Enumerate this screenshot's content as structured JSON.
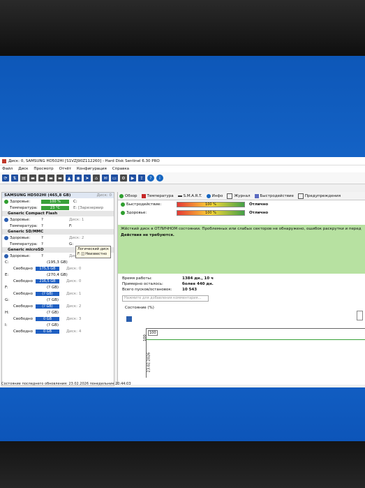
{
  "window": {
    "title": "Диск: 0, SAMSUNG HD502HI [S1VZJ90Z112260] - Hard Disk Sentinel 6.30 PRO"
  },
  "menu": [
    "Файл",
    "Диск",
    "Просмотр",
    "Отчёт",
    "Конфигурация",
    "Справка"
  ],
  "disk_panel": {
    "header": "SAMSUNG HD502HI (465,8 GB)",
    "header_num": "Диск: 0",
    "health_label": "Здоровье:",
    "health_value": "100 %",
    "health_drive": "C:",
    "temp_label": "Температура:",
    "temp_value": "23 °C",
    "temp_drive": "E: [Зарезервир",
    "devices": [
      {
        "name": "Generic Compact Flash",
        "health_label": "Здоровье:",
        "health": "?",
        "temp_label": "Температура:",
        "temp": "?",
        "disk": "Диск: 1",
        "drive": "F:"
      },
      {
        "name": "Generic SD/MMC",
        "health_label": "Здоровье:",
        "health": "?",
        "temp_label": "Температура:",
        "temp": "?",
        "disk": "Диск: 2",
        "drive": "G:"
      },
      {
        "name": "Generic microSD",
        "health_label": "Здоровье:",
        "health": "?",
        "temp_label": "",
        "temp": "",
        "disk": "Диск: 3",
        "drive": ""
      }
    ],
    "tooltip_line1": "Логический диск",
    "tooltip_line2": "F: [] Неизвестно",
    "volumes": [
      {
        "letter": "C:",
        "size": "(195,3 GB)",
        "free_label": "Свободно",
        "free": "175,5 GB",
        "disk": "Диск: 0"
      },
      {
        "letter": "E:",
        "size": "(270,4 GB)",
        "free_label": "Свободно",
        "free": "216,5 GB",
        "disk": "Диск: 0"
      },
      {
        "letter": "F:",
        "size": "(? GB)",
        "free_label": "Свободно",
        "free": "(? GB)",
        "disk": "Диск: 1"
      },
      {
        "letter": "G:",
        "size": "(? GB)",
        "free_label": "Свободно",
        "free": "(? GB)",
        "disk": "Диск: 2"
      },
      {
        "letter": "H:",
        "size": "(? GB)",
        "free_label": "Свободно",
        "free": "0 GB",
        "disk": "Диск: 3"
      },
      {
        "letter": "I:",
        "size": "(? GB)",
        "free_label": "Свободно",
        "free": "0 GB",
        "disk": "Диск: 4"
      }
    ]
  },
  "tabs": [
    "Обзор",
    "Температура",
    "S.M.A.R.T.",
    "Инфо",
    "Журнал",
    "Быстродействие",
    "Предупреждения"
  ],
  "status": {
    "perf_label": "Быстродействие:",
    "perf_value": "100 %",
    "perf_rating": "Отлично",
    "health_label": "Здоровье:",
    "health_value": "100 %",
    "health_rating": "Отлично"
  },
  "message": {
    "line1": "Жёсткий диск в ОТЛИЧНОМ состоянии. Проблемных или слабых секторов не обнаружено, ошибок раскрутки и перед",
    "line2": "Действия не требуются."
  },
  "stats": [
    {
      "key": "Время работы:",
      "value": "1384 дн., 10 ч"
    },
    {
      "key": "Примерно осталось:",
      "value": "более 440 дн."
    },
    {
      "key": "Всего пусков/остановок:",
      "value": "10 543"
    }
  ],
  "comment_placeholder": "Нажмите для добавления комментария...",
  "graph": {
    "label": "Состояние (%)",
    "ytick": "100",
    "box_value": "100",
    "date": "23.02.2026",
    "value": 100
  },
  "statusbar": "Состояние последнего обновления: 23.02.2026 понедельник 20:44:03"
}
